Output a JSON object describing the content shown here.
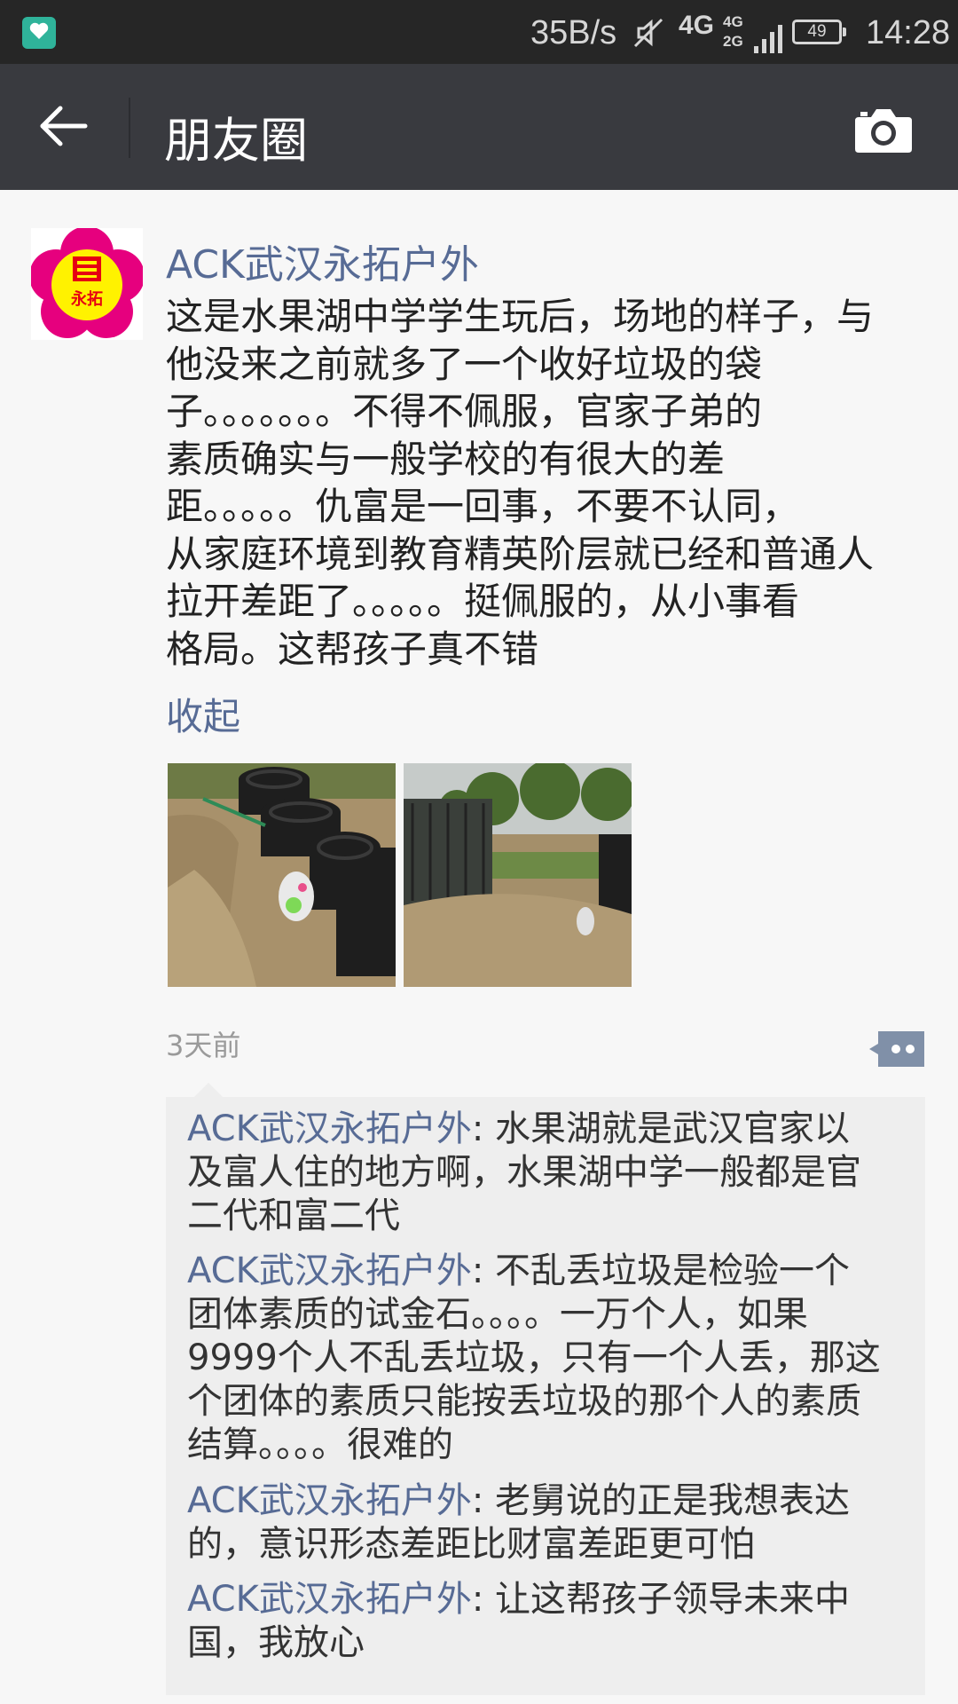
{
  "status_bar": {
    "network_speed": "35B/s",
    "network_type": "4G",
    "network_secondary": [
      "4G",
      "2G"
    ],
    "battery": "49",
    "time": "14:28"
  },
  "nav": {
    "title": "朋友圈",
    "back_icon": "back-arrow-icon",
    "camera_icon": "camera-icon"
  },
  "post": {
    "author": "ACK武汉永拓户外",
    "avatar_text": "永拓",
    "text_lines": [
      "这是水果湖中学学生玩后，场地的样子，与",
      "他没来之前就多了一个收好垃圾的袋",
      "子。。。。。。。不得不佩服，官家子弟的",
      "素质确实与一般学校的有很大的差",
      "距。。。。。仇富是一回事，不要不认同，",
      "从家庭环境到教育精英阶层就已经和普通人",
      "拉开差距了。。。。。挺佩服的，从小事看",
      "格局。这帮孩子真不错"
    ],
    "collapse_label": "收起",
    "time_ago": "3天前"
  },
  "comments": [
    {
      "author": "ACK武汉永拓户外",
      "lines": [
        "水果湖就是武汉官家以",
        "及富人住的地方啊，水果湖中学一般都是官",
        "二代和富二代"
      ]
    },
    {
      "author": "ACK武汉永拓户外",
      "lines": [
        "不乱丢垃圾是检验一个",
        "团体素质的试金石。。。。一万个人，如果",
        "9999个人不乱丢垃圾，只有一个人丢，那这",
        "个团体的素质只能按丢垃圾的那个人的素质",
        "结算。。。。很难的"
      ]
    },
    {
      "author": "ACK武汉永拓户外",
      "lines": [
        "老舅说的正是我想表达",
        "的，意识形态差距比财富差距更可怕"
      ]
    },
    {
      "author": "ACK武汉永拓户外",
      "lines": [
        "让这帮孩子领导未来中",
        "国，我放心"
      ]
    }
  ],
  "colors": {
    "link": "#576b95",
    "nav_bg": "#393a3f",
    "status_bg": "#262626",
    "comment_bg": "#eeeeee"
  }
}
